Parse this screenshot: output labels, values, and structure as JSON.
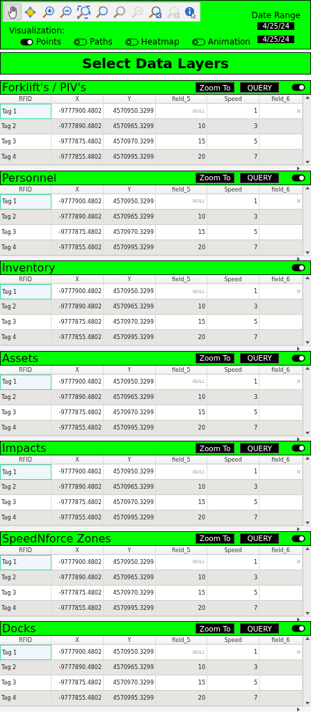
{
  "toolbar": {
    "tools": [
      {
        "kind": "pan",
        "selected": true,
        "disabled": false
      },
      {
        "kind": "move",
        "selected": false,
        "disabled": false
      },
      {
        "kind": "zoom_in",
        "selected": false,
        "disabled": false
      },
      {
        "kind": "zoom_out",
        "selected": false,
        "disabled": false
      },
      {
        "kind": "zoom_full",
        "selected": false,
        "disabled": false
      },
      {
        "kind": "zoom_layer",
        "selected": false,
        "disabled": false
      },
      {
        "kind": "zoom_selection",
        "selected": false,
        "disabled": false
      },
      {
        "kind": "zoom_native",
        "selected": false,
        "disabled": true
      },
      {
        "kind": "zoom_last",
        "selected": false,
        "disabled": false
      },
      {
        "kind": "zoom_next",
        "selected": false,
        "disabled": true
      },
      {
        "kind": "identify",
        "selected": false,
        "disabled": false
      }
    ]
  },
  "visualization": {
    "label": "Visualization:",
    "options": [
      {
        "label": "Points",
        "on": true
      },
      {
        "label": "Paths",
        "on": false
      },
      {
        "label": "Heatmap",
        "on": false
      },
      {
        "label": "Animation",
        "on": false
      }
    ]
  },
  "date_range": {
    "label": "Date Range",
    "start": "4/25/24",
    "end": "4/25/24"
  },
  "heading": "Select Data Layers",
  "layers": [
    {
      "title": "Forklift's / PIV's",
      "buttons": [
        "Zoom To",
        "QUERY"
      ],
      "on": true,
      "table": {
        "columns": [
          "RFID",
          "X",
          "Y",
          "field_5",
          "Speed",
          "field_6"
        ],
        "rows": [
          {
            "selected": true,
            "cells": [
              "Tag 1",
              "-9777900.4802",
              "4570950.3299",
              {
                "text": "NULL",
                "kind": "null"
              },
              "1",
              {
                "text": "N",
                "kind": "null"
              }
            ]
          },
          {
            "selected": false,
            "cells": [
              "Tag 2",
              "-9777890.4802",
              "4570965.3299",
              "10",
              "3"
            ]
          },
          {
            "selected": false,
            "cells": [
              "Tag 3",
              "-9777875.4802",
              "4570970.3299",
              "15",
              "5"
            ]
          },
          {
            "selected": false,
            "cells": [
              "Tag 4",
              "-9777855.4802",
              "4570995.3299",
              "20",
              "7"
            ]
          }
        ]
      }
    },
    {
      "title": "Personnel",
      "buttons": [
        "Zoom To",
        "QUERY"
      ],
      "on": true,
      "table": {
        "columns": [
          "RFID",
          "X",
          "Y",
          "field_5",
          "Speed",
          "field_6"
        ],
        "rows": [
          {
            "selected": true,
            "cells": [
              "Tag 1",
              "-9777900.4802",
              "4570950.3299",
              {
                "text": "NULL",
                "kind": "null"
              },
              "1",
              {
                "text": "N",
                "kind": "null"
              }
            ]
          },
          {
            "selected": false,
            "cells": [
              "Tag 2",
              "-9777890.4802",
              "4570965.3299",
              "10",
              "3"
            ]
          },
          {
            "selected": false,
            "cells": [
              "Tag 3",
              "-9777875.4802",
              "4570970.3299",
              "15",
              "5"
            ]
          },
          {
            "selected": false,
            "cells": [
              "Tag 4",
              "-9777855.4802",
              "4570995.3299",
              "20",
              "7"
            ]
          }
        ]
      }
    },
    {
      "title": "Inventory",
      "on": true,
      "table": {
        "columns": [
          "RFID",
          "X",
          "Y",
          "field_5",
          "Speed",
          "field_6"
        ],
        "rows": [
          {
            "selected": true,
            "cells": [
              "Tag 1",
              "-9777900.4802",
              "4570950.3299",
              {
                "text": "NULL",
                "kind": "null"
              },
              "1",
              {
                "text": "N",
                "kind": "null"
              }
            ]
          },
          {
            "selected": false,
            "cells": [
              "Tag 2",
              "-9777890.4802",
              "4570965.3299",
              "10",
              "3"
            ]
          },
          {
            "selected": false,
            "cells": [
              "Tag 3",
              "-9777875.4802",
              "4570970.3299",
              "15",
              "5"
            ]
          },
          {
            "selected": false,
            "cells": [
              "Tag 4",
              "-9777855.4802",
              "4570995.3299",
              "20",
              "7"
            ]
          }
        ]
      }
    },
    {
      "title": "Assets",
      "buttons": [
        "Zoom To",
        "QUERY"
      ],
      "on": true,
      "table": {
        "columns": [
          "RFID",
          "X",
          "Y",
          "field_5",
          "Speed",
          "field_6"
        ],
        "rows": [
          {
            "selected": true,
            "cells": [
              "Tag 1",
              "-9777900.4802",
              "4570950.3299",
              {
                "text": "NULL",
                "kind": "null"
              },
              "1",
              {
                "text": "N",
                "kind": "null"
              }
            ]
          },
          {
            "selected": false,
            "cells": [
              "Tag 2",
              "-9777890.4802",
              "4570965.3299",
              "10",
              "3"
            ]
          },
          {
            "selected": false,
            "cells": [
              "Tag 3",
              "-9777875.4802",
              "4570970.3299",
              "15",
              "5"
            ]
          },
          {
            "selected": false,
            "cells": [
              "Tag 4",
              "-9777855.4802",
              "4570995.3299",
              "20",
              "7"
            ]
          }
        ]
      }
    },
    {
      "title": "Impacts",
      "buttons": [
        "Zoom To",
        "QUERY"
      ],
      "on": true,
      "table": {
        "columns": [
          "RFID",
          "X",
          "Y",
          "field_5",
          "Speed",
          "field_6"
        ],
        "rows": [
          {
            "selected": true,
            "cells": [
              "Tag 1",
              "-9777900.4802",
              "4570950.3299",
              {
                "text": "NULL",
                "kind": "null"
              },
              "1",
              {
                "text": "N",
                "kind": "null"
              }
            ]
          },
          {
            "selected": false,
            "cells": [
              "Tag 2",
              "-9777890.4802",
              "4570965.3299",
              "10",
              "3"
            ]
          },
          {
            "selected": false,
            "cells": [
              "Tag 3",
              "-9777875.4802",
              "4570970.3299",
              "15",
              "5"
            ]
          },
          {
            "selected": false,
            "cells": [
              "Tag 4",
              "-9777855.4802",
              "4570995.3299",
              "20",
              "7"
            ]
          }
        ]
      }
    },
    {
      "title": "SpeedNforce Zones",
      "buttons": [
        "Zoom To",
        "QUERY"
      ],
      "on": true,
      "table": {
        "columns": [
          "RFID",
          "X",
          "Y",
          "field_5",
          "Speed",
          "field_6"
        ],
        "rows": [
          {
            "selected": true,
            "cells": [
              "Tag 1",
              "-9777900.4802",
              "4570950.3299",
              {
                "text": "NULL",
                "kind": "null"
              },
              "1",
              {
                "text": "N",
                "kind": "null"
              }
            ]
          },
          {
            "selected": false,
            "cells": [
              "Tag 2",
              "-9777890.4802",
              "4570965.3299",
              "10",
              "3"
            ]
          },
          {
            "selected": false,
            "cells": [
              "Tag 3",
              "-9777875.4802",
              "4570970.3299",
              "15",
              "5"
            ]
          },
          {
            "selected": false,
            "cells": [
              "Tag 4",
              "-9777855.4802",
              "4570995.3299",
              "20",
              "7"
            ]
          }
        ]
      }
    },
    {
      "title": "Docks",
      "buttons": [
        "Zoom To",
        "QUERY"
      ],
      "on": true,
      "table": {
        "columns": [
          "RFID",
          "X",
          "Y",
          "field_5",
          "Speed",
          "field_6"
        ],
        "rows": [
          {
            "selected": true,
            "cells": [
              "Tag 1",
              "-9777900.4802",
              "4570950.3299",
              {
                "text": "NULL",
                "kind": "null"
              },
              "1",
              {
                "text": "N",
                "kind": "null"
              }
            ]
          },
          {
            "selected": false,
            "cells": [
              "Tag 2",
              "-9777890.4802",
              "4570965.3299",
              "10",
              "3"
            ]
          },
          {
            "selected": false,
            "cells": [
              "Tag 3",
              "-9777875.4802",
              "4570970.3299",
              "15",
              "5"
            ]
          },
          {
            "selected": false,
            "cells": [
              "Tag 4",
              "-9777855.4802",
              "4570995.3299",
              "20",
              "7"
            ]
          }
        ]
      }
    }
  ]
}
